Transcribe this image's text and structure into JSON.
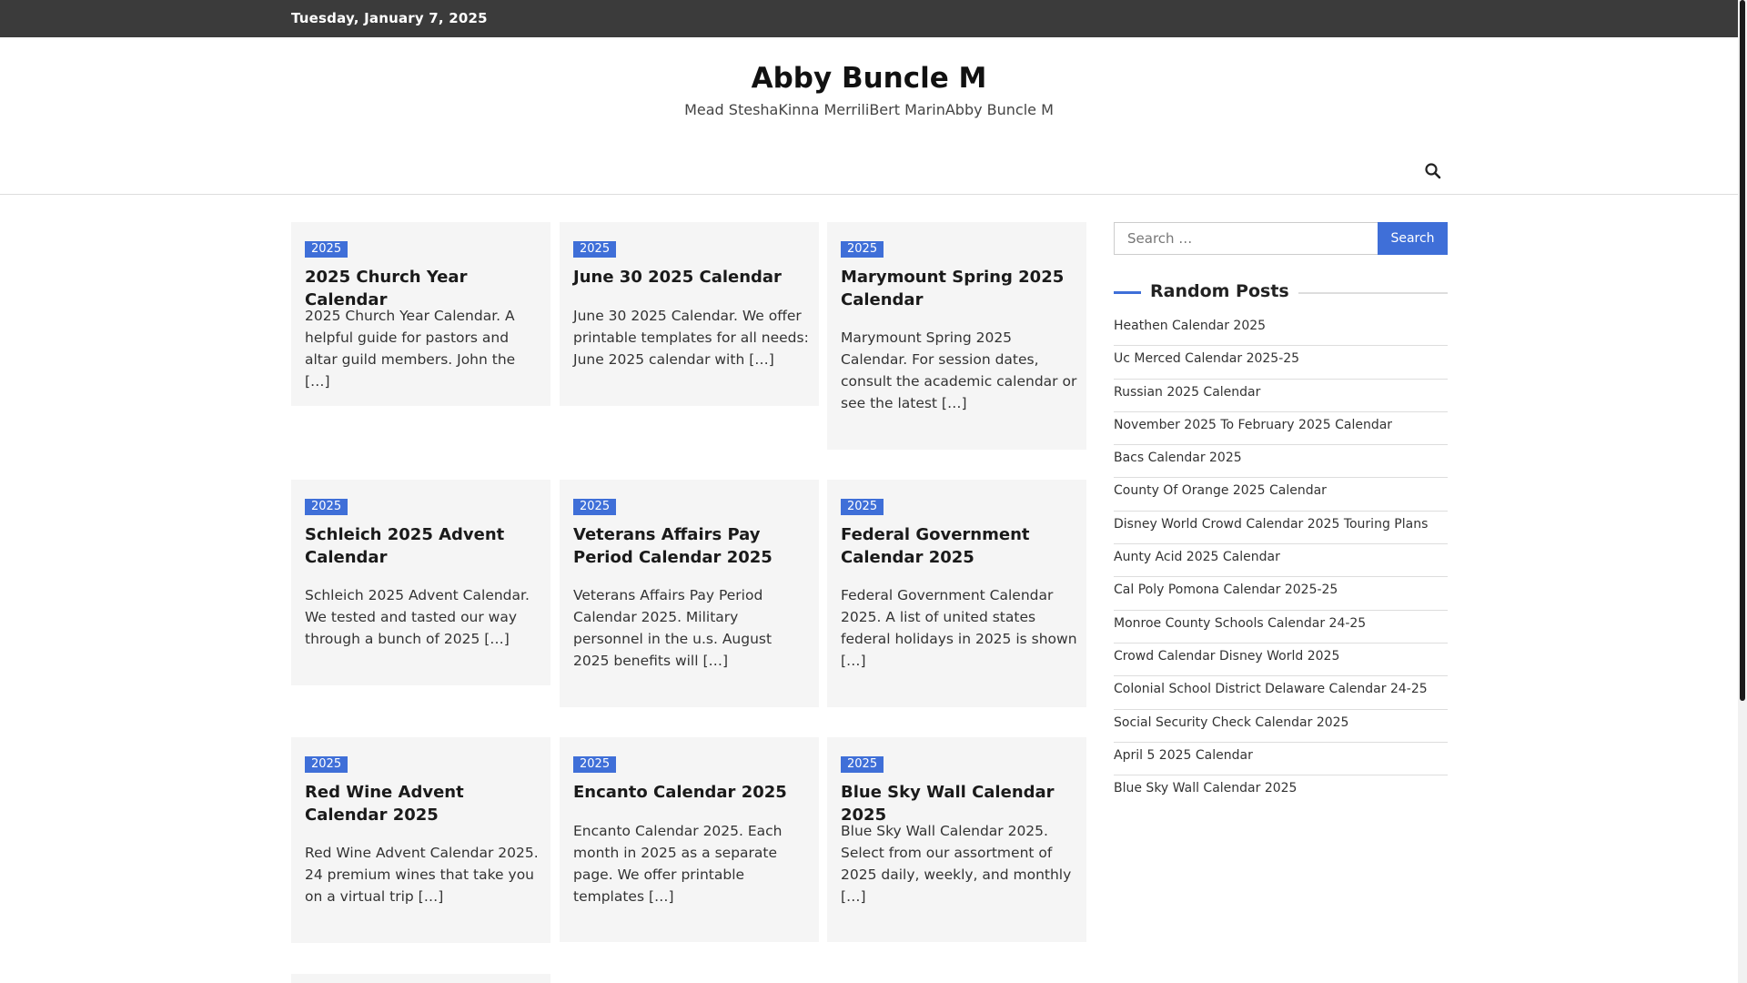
{
  "topbar": {
    "date": "Tuesday, January 7, 2025"
  },
  "site": {
    "title": "Abby Buncle M",
    "description": "Mead SteshaKinna MerriliBert MarinAbby Buncle M"
  },
  "nav": {
    "search_icon": "search-icon"
  },
  "posts": [
    {
      "category": "2025",
      "title": "2025 Church Year Calendar",
      "excerpt": "2025 Church Year Calendar. A helpful guide for pastors and altar guild members. John the […]"
    },
    {
      "category": "2025",
      "title": "June 30 2025 Calendar",
      "excerpt": "June 30 2025 Calendar. We offer printable templates for all needs: June 2025 calendar with […]"
    },
    {
      "category": "2025",
      "title": "Marymount Spring 2025 Calendar",
      "excerpt": "Marymount Spring 2025 Calendar. For session dates, consult the academic calendar or see the latest […]"
    },
    {
      "category": "2025",
      "title": "Schleich 2025 Advent Calendar",
      "excerpt": "Schleich 2025 Advent Calendar. We tested and tasted our way through a bunch of 2025 […]"
    },
    {
      "category": "2025",
      "title": "Veterans Affairs Pay Period Calendar 2025",
      "excerpt": "Veterans Affairs Pay Period Calendar 2025. Military personnel in the u.s. August 2025 benefits will […]"
    },
    {
      "category": "2025",
      "title": "Federal Government Calendar 2025",
      "excerpt": "Federal Government Calendar 2025. A list of united states federal holidays in 2025 is shown […]"
    },
    {
      "category": "2025",
      "title": "Red Wine Advent Calendar 2025",
      "excerpt": "Red Wine Advent Calendar 2025. 24 premium wines that take you on a virtual trip […]"
    },
    {
      "category": "2025",
      "title": "Encanto Calendar 2025",
      "excerpt": "Encanto Calendar 2025. Each month in 2025 as a separate page. We offer printable templates […]"
    },
    {
      "category": "2025",
      "title": "Blue Sky Wall Calendar 2025",
      "excerpt": "Blue Sky Wall Calendar 2025. Select from our assortment of 2025 daily, weekly, and monthly […]"
    }
  ],
  "sidebar": {
    "search": {
      "placeholder": "Search …",
      "button": "Search"
    },
    "random_posts": {
      "heading": "Random Posts",
      "items": [
        "Heathen Calendar 2025",
        "Uc Merced Calendar 2025-25",
        "Russian 2025 Calendar",
        "November 2025 To February 2025 Calendar",
        "Bacs Calendar 2025",
        "County Of Orange 2025 Calendar",
        "Disney World Crowd Calendar 2025 Touring Plans",
        "Aunty Acid 2025 Calendar",
        "Cal Poly Pomona Calendar 2025-25",
        "Monroe County Schools Calendar 24-25",
        "Crowd Calendar Disney World 2025",
        "Colonial School District Delaware Calendar 24-25",
        "Social Security Check Calendar 2025",
        "April 5 2025 Calendar",
        "Blue Sky Wall Calendar 2025"
      ]
    }
  },
  "colors": {
    "accent": "#3f6fd8",
    "topbar": "#3b3b3b",
    "card_bg": "#f5f5f5"
  }
}
